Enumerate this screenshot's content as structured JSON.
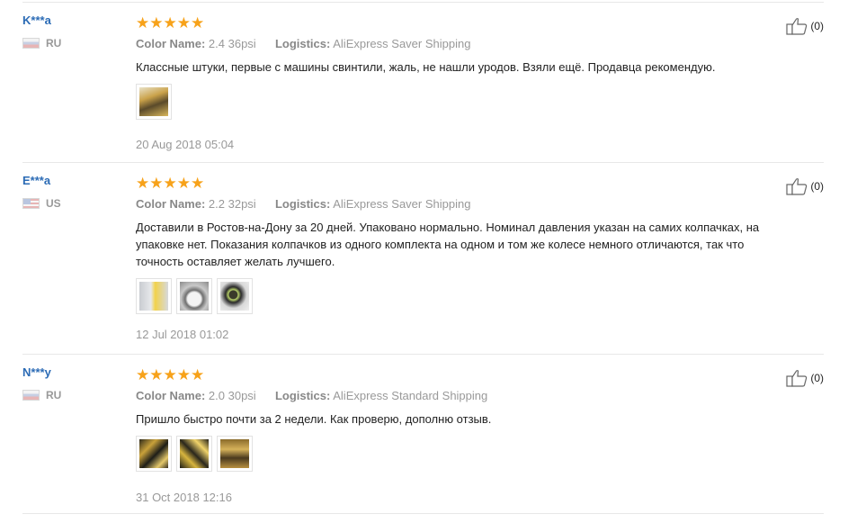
{
  "reviews": [
    {
      "user": "K***a",
      "country": "RU",
      "flag": "ru",
      "stars": "★★★★★",
      "color_label": "Color Name:",
      "color_value": "2.4 36psi",
      "logistics_label": "Logistics:",
      "logistics_value": "AliExpress Saver Shipping",
      "text": "Классные штуки, первые с машины свинтили, жаль, не нашли уродов. Взяли ещё. Продавца рекомендую.",
      "photos": [
        "photo-tire-caps-package"
      ],
      "date": "20 Aug 2018 05:04",
      "helpful": "(0)"
    },
    {
      "user": "E***a",
      "country": "US",
      "flag": "us",
      "stars": "★★★★★",
      "color_label": "Color Name:",
      "color_value": "2.2 32psi",
      "logistics_label": "Logistics:",
      "logistics_value": "AliExpress Saver Shipping",
      "text": "Доставили в Ростов-на-Дону за 20 дней. Упаковано нормально. Номинал давления указан на самих колпачках, на\nупаковке нет. Показания колпачков из одного комплекта на одном и том же колесе немного отличаются, так что\nточность оставляет желать лучшего.",
      "photos": [
        "photo-package",
        "photo-wheel",
        "photo-valve-cap"
      ],
      "date": "12 Jul 2018 01:02",
      "helpful": "(0)"
    },
    {
      "user": "N***y",
      "country": "RU",
      "flag": "ru",
      "stars": "★★★★★",
      "color_label": "Color Name:",
      "color_value": "2.0 30psi",
      "logistics_label": "Logistics:",
      "logistics_value": "AliExpress Standard Shipping",
      "text": "Пришло быстро почти за 2 недели. Как проверю, дополню отзыв.",
      "photos": [
        "photo-caps-hand",
        "photo-caps-closeup",
        "photo-caps-package"
      ],
      "date": "31 Oct 2018 12:16",
      "helpful": "(0)"
    }
  ],
  "colors": {
    "star": "#f7a21a",
    "username": "#2b6bb5",
    "meta": "#999999"
  }
}
